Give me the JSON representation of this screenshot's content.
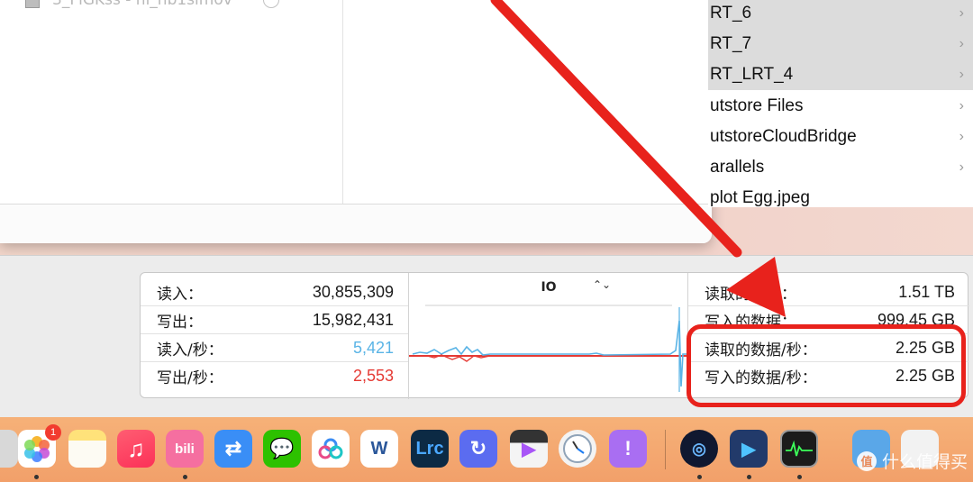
{
  "finder": {
    "partial_file_name": "3_FlGKss - nl_nb1slmov",
    "right_column_items": [
      {
        "label": "RT_6",
        "selected": true
      },
      {
        "label": "RT_7",
        "selected": true
      },
      {
        "label": "RT_LRT_4",
        "selected": true
      },
      {
        "label": "utstore Files",
        "selected": false
      },
      {
        "label": "utstoreCloudBridge",
        "selected": false
      },
      {
        "label": "arallels",
        "selected": false
      },
      {
        "label": "plot Egg.jpeg",
        "selected": false
      }
    ]
  },
  "activity_monitor": {
    "left_stats": [
      {
        "label": "读入：",
        "value": "30,855,309"
      },
      {
        "label": "写出：",
        "value": "15,982,431"
      },
      {
        "label": "读入/秒：",
        "value": "5,421"
      },
      {
        "label": "写出/秒：",
        "value": "2,553"
      }
    ],
    "chart": {
      "title": "IO",
      "selector_icon": "updown-chevron-icon",
      "read_color": "#5ab4e6",
      "write_color": "#e53a34"
    },
    "right_stats": [
      {
        "label": "读取的数据：",
        "value": "1.51 TB"
      },
      {
        "label": "写入的数据：",
        "value": "999.45 GB"
      },
      {
        "label": "读取的数据/秒：",
        "value": "2.25 GB"
      },
      {
        "label": "写入的数据/秒：",
        "value": "2.25 GB"
      }
    ]
  },
  "annotation": {
    "color": "#e8221c"
  },
  "dock": {
    "photos_badge": "1",
    "bilibili_label": "bili",
    "word_label": "W",
    "lrc_label": "Lrc"
  },
  "watermark": {
    "logo_text": "值",
    "text": "什么值得买"
  }
}
